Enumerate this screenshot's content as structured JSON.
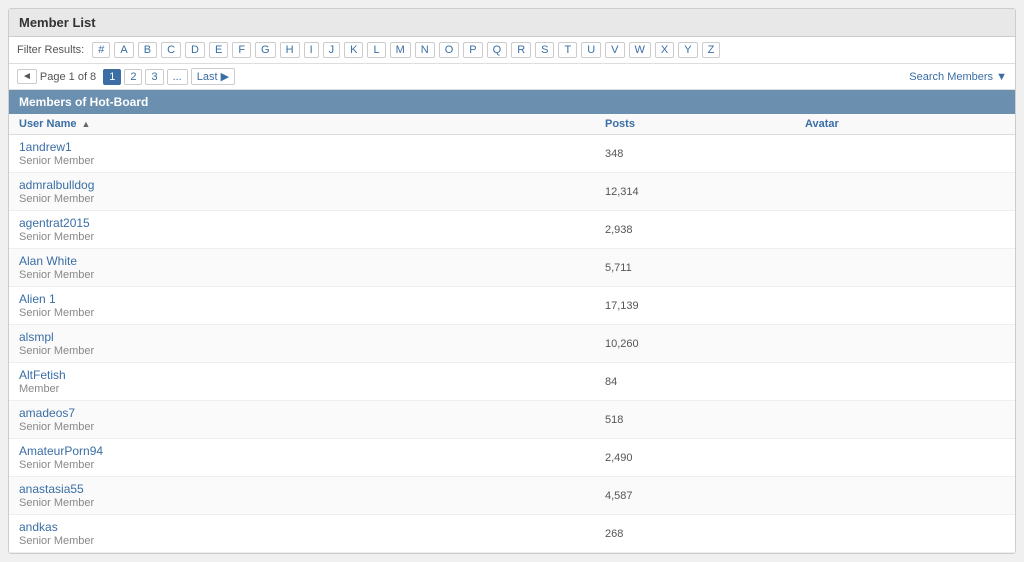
{
  "page": {
    "title": "Member List",
    "section_title": "Members of Hot-Board"
  },
  "filter": {
    "label": "Filter Results:",
    "letters": [
      "#",
      "A",
      "B",
      "C",
      "D",
      "E",
      "F",
      "G",
      "H",
      "I",
      "J",
      "K",
      "L",
      "M",
      "N",
      "O",
      "P",
      "Q",
      "R",
      "S",
      "T",
      "U",
      "V",
      "W",
      "X",
      "Y",
      "Z"
    ]
  },
  "pagination": {
    "info": "Page 1 of 8",
    "prev_label": "◄",
    "pages": [
      "1",
      "2",
      "3",
      "..."
    ],
    "last_label": "Last ▶",
    "search_label": "Search Members ▼"
  },
  "table": {
    "columns": [
      {
        "label": "User Name",
        "sort": "▲"
      },
      {
        "label": "Posts"
      },
      {
        "label": "Avatar"
      }
    ]
  },
  "members": [
    {
      "name": "1andrew1",
      "role": "Senior Member",
      "posts": "348",
      "avatar": ""
    },
    {
      "name": "admralbulldog",
      "role": "Senior Member",
      "posts": "12,314",
      "avatar": ""
    },
    {
      "name": "agentrat2015",
      "role": "Senior Member",
      "posts": "2,938",
      "avatar": ""
    },
    {
      "name": "Alan White",
      "role": "Senior Member",
      "posts": "5,711",
      "avatar": ""
    },
    {
      "name": "Alien 1",
      "role": "Senior Member",
      "posts": "17,139",
      "avatar": ""
    },
    {
      "name": "alsmpl",
      "role": "Senior Member",
      "posts": "10,260",
      "avatar": ""
    },
    {
      "name": "AltFetish",
      "role": "Member",
      "posts": "84",
      "avatar": ""
    },
    {
      "name": "amadeos7",
      "role": "Senior Member",
      "posts": "518",
      "avatar": ""
    },
    {
      "name": "AmateurPorn94",
      "role": "Senior Member",
      "posts": "2,490",
      "avatar": ""
    },
    {
      "name": "anastasia55",
      "role": "Senior Member",
      "posts": "4,587",
      "avatar": ""
    },
    {
      "name": "andkas",
      "role": "Senior Member",
      "posts": "268",
      "avatar": ""
    }
  ]
}
